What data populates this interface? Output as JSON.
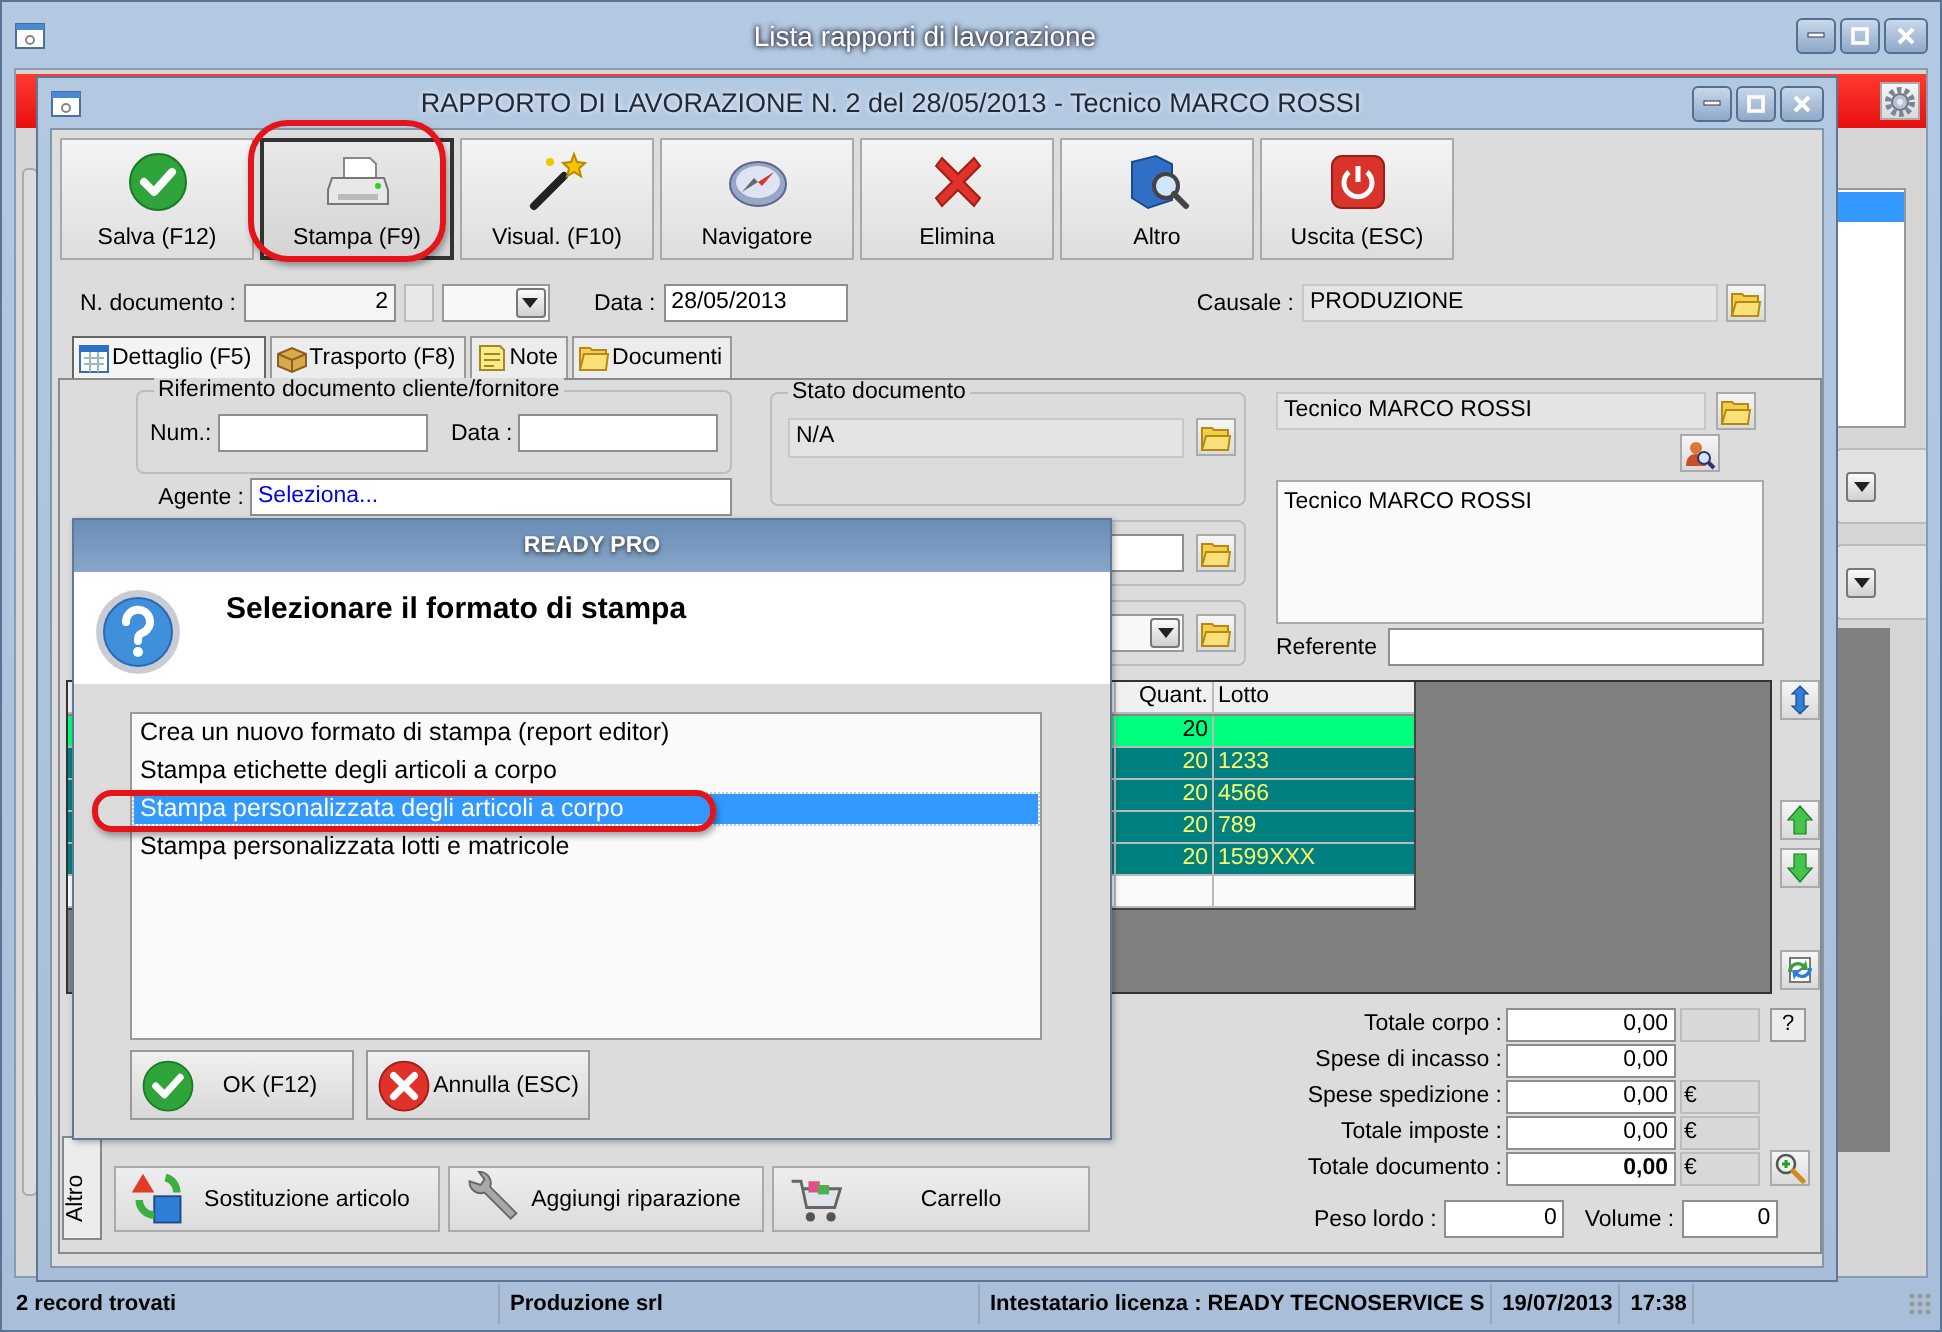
{
  "main_window": {
    "title": "Lista rapporti di lavorazione"
  },
  "document_window": {
    "title": "RAPPORTO DI LAVORAZIONE N. 2 del 28/05/2013 - Tecnico MARCO ROSSI"
  },
  "toolbar": [
    {
      "label": "Salva (F12)",
      "focused": false
    },
    {
      "label": "Stampa (F9)",
      "focused": true
    },
    {
      "label": "Visual. (F10)",
      "focused": false
    },
    {
      "label": "Navigatore",
      "focused": false
    },
    {
      "label": "Elimina",
      "focused": false
    },
    {
      "label": "Altro",
      "focused": false
    },
    {
      "label": "Uscita (ESC)",
      "focused": false
    }
  ],
  "header": {
    "number_label": "N. documento :",
    "number": "2",
    "date_label": "Data :",
    "date": "28/05/2013",
    "reason_label": "Causale :",
    "reason": "PRODUZIONE"
  },
  "tabs": [
    {
      "label": "Dettaglio (F5)",
      "selected": true
    },
    {
      "label": "Trasporto (F8)",
      "selected": false
    },
    {
      "label": "Note",
      "selected": false
    },
    {
      "label": "Documenti",
      "selected": false
    }
  ],
  "customer_reference": {
    "legend": "Riferimento documento cliente/fornitore",
    "number_label": "Num.:",
    "date_label": "Data :"
  },
  "agent": {
    "label": "Agente :",
    "value": "Seleziona..."
  },
  "document_status": {
    "legend": "Stato documento",
    "value": "N/A"
  },
  "technician": {
    "value": "Tecnico MARCO ROSSI",
    "notes": "Tecnico MARCO ROSSI"
  },
  "contact": {
    "label": "Referente"
  },
  "table": {
    "columns": [
      "Quant.",
      "Lotto"
    ],
    "rows": [
      {
        "quantity": "20",
        "selected": true
      },
      {
        "quantity": "20",
        "lot": "1233",
        "selected": false
      },
      {
        "quantity": "20",
        "lot": "4566",
        "selected": false
      },
      {
        "quantity": "20",
        "lot": "789",
        "selected": false
      },
      {
        "quantity": "20",
        "lot": "1599XXX",
        "selected": false
      }
    ]
  },
  "totals": [
    {
      "kind": "help",
      "label": "Totale corpo :",
      "value": "0,00",
      "help": "?"
    },
    {
      "kind": "plain",
      "label": "Spese di incasso :",
      "value": "0,00"
    },
    {
      "kind": "currency",
      "label": "Spese spedizione :",
      "value": "0,00",
      "currency": "€"
    },
    {
      "kind": "currency",
      "label": "Totale imposte :",
      "value": "0,00",
      "currency": "€"
    },
    {
      "kind": "total",
      "label": "Totale documento :",
      "value": "0,00",
      "currency": "€"
    }
  ],
  "measures": [
    {
      "label": "Peso lordo :",
      "value": "0"
    },
    {
      "label": "Volume :",
      "value": "0"
    }
  ],
  "side_tab": "Altro",
  "actions": [
    "Sostituzione articolo",
    "Aggiungi riparazione",
    "Carrello"
  ],
  "dialog": {
    "title": "READY PRO",
    "heading": "Selezionare il formato di stampa",
    "options": [
      {
        "label": "Crea un nuovo formato di stampa (report editor)",
        "selected": false
      },
      {
        "label": "Stampa etichette degli articoli a corpo",
        "selected": false
      },
      {
        "label": "Stampa personalizzata degli articoli a corpo",
        "selected": true
      },
      {
        "label": "Stampa personalizzata lotti e matricole",
        "selected": false
      }
    ],
    "buttons": [
      "OK (F12)",
      "Annulla (ESC)"
    ]
  },
  "status_bar": [
    "2 record trovati",
    "Produzione srl",
    "Intestatario licenza : READY TECNOSERVICE S",
    "19/07/2013",
    "17:38"
  ]
}
